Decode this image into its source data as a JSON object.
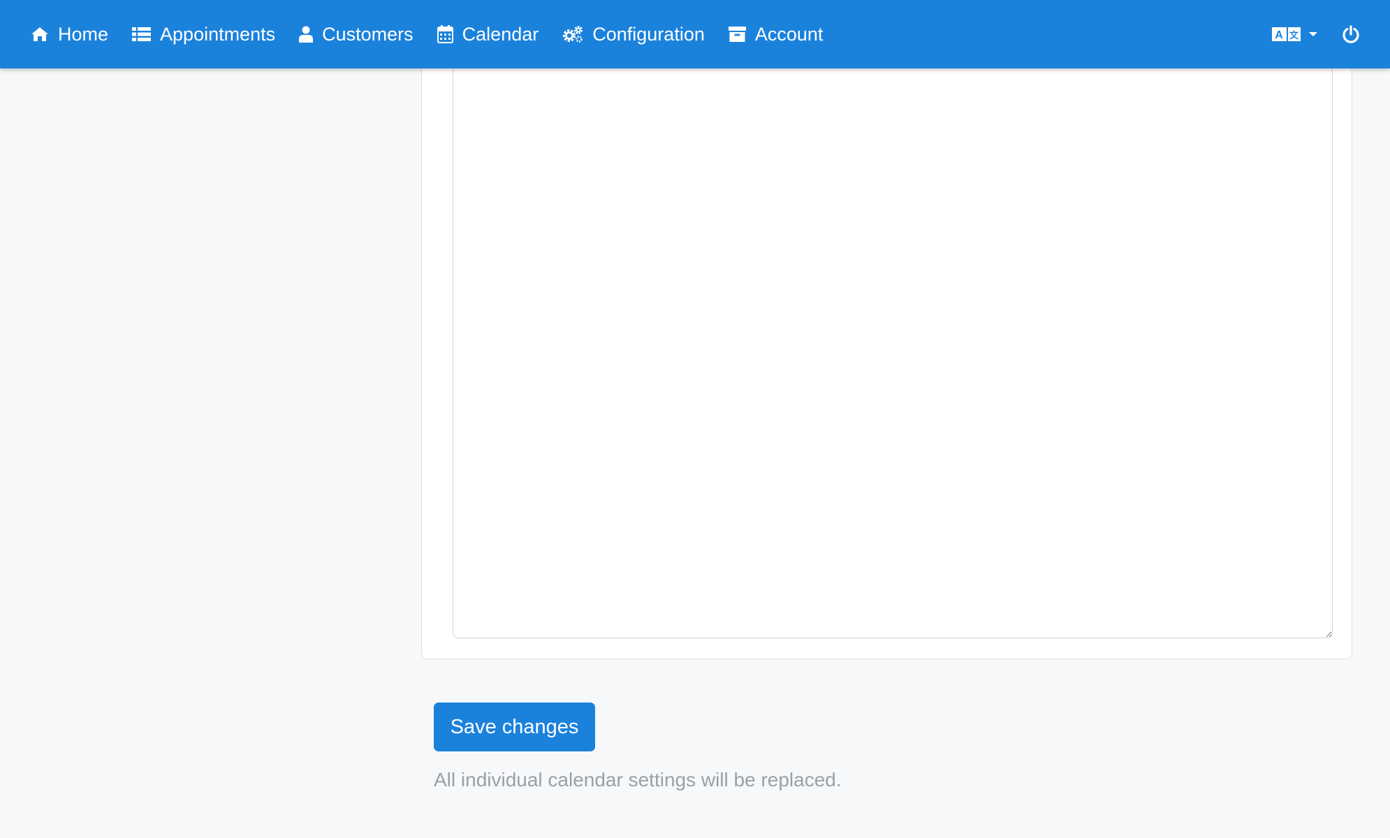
{
  "navbar": {
    "items": [
      {
        "label": "Home",
        "icon": "home-icon"
      },
      {
        "label": "Appointments",
        "icon": "list-icon"
      },
      {
        "label": "Customers",
        "icon": "user-icon"
      },
      {
        "label": "Calendar",
        "icon": "calendar-icon"
      },
      {
        "label": "Configuration",
        "icon": "cogs-icon"
      },
      {
        "label": "Account",
        "icon": "archive-icon"
      }
    ],
    "language_icon": "language-icon",
    "dropdown_icon": "caret-down-icon",
    "logout_icon": "power-icon"
  },
  "form": {
    "textarea_value": "",
    "save_label": "Save changes",
    "hint": "All individual calendar settings will be replaced."
  },
  "colors": {
    "primary": "#1b82dc",
    "background": "#f6f8fa",
    "hint_text": "#9aa0a6"
  }
}
